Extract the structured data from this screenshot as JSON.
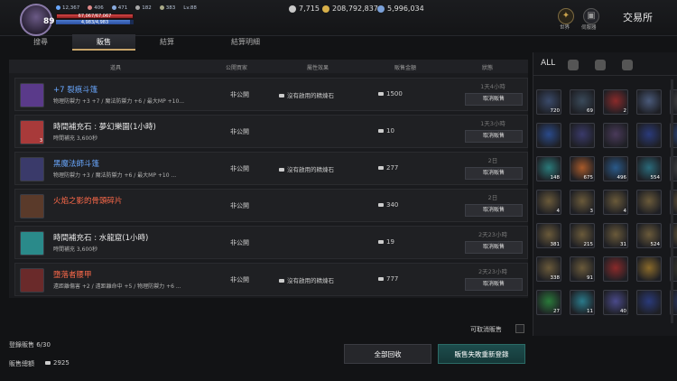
{
  "player": {
    "level": "89",
    "stats": [
      "12,367",
      "406",
      "471",
      "182",
      "383"
    ],
    "lvl_tag": "Lv.88",
    "hp_text": "67,067/67,067",
    "mp_text": "4,983/4,983"
  },
  "currency": [
    {
      "value": "7,715",
      "color": "#c8c8c8"
    },
    {
      "value": "208,792,837",
      "color": "#d8b04a"
    },
    {
      "value": "5,996,034",
      "color": "#7aa0d8"
    }
  ],
  "top_icons": [
    {
      "label": "世界"
    },
    {
      "label": "伺服器"
    }
  ],
  "page_title": "交易所",
  "tabs": [
    "搜尋",
    "販售",
    "結算",
    "結算明細"
  ],
  "header": {
    "item": "道具",
    "public": "公開買家",
    "attr": "屬性效果",
    "price": "販售金額",
    "status": "狀態"
  },
  "rows": [
    {
      "name": "+7 裂痕斗篷",
      "name_class": "blue",
      "desc": "物理防禦力 +3 +7 / 魔法防禦力 +6 / 最大MP +10...",
      "pub": "非公開",
      "attr": "沒有啟用的精煉石",
      "price": "1500",
      "time": "1天4小時",
      "button": "取消販售",
      "icon_color": "#5a3a8a",
      "count": ""
    },
    {
      "name": "時間補充石 : 夢幻樂園(1小時)",
      "name_class": "white",
      "desc": "時間補充 3,600秒",
      "pub": "非公開",
      "attr": "",
      "price": "10",
      "time": "1天3小時",
      "button": "取消販售",
      "icon_color": "#a83a3a",
      "count": "3"
    },
    {
      "name": "黑魔法師斗篷",
      "name_class": "blue",
      "desc": "物理防禦力 +3 / 魔法防禦力 +6 / 最大MP +10 ...",
      "pub": "非公開",
      "attr": "沒有啟用的精煉石",
      "price": "277",
      "time": "2日",
      "button": "取消販售",
      "icon_color": "#3a3a6a",
      "count": ""
    },
    {
      "name": "火焰之影的骨頭碎片",
      "name_class": "red",
      "desc": "",
      "pub": "非公開",
      "attr": "",
      "price": "340",
      "time": "2日",
      "button": "取消販售",
      "icon_color": "#5a3a2a",
      "count": ""
    },
    {
      "name": "時間補充石 : 水龍窟(1小時)",
      "name_class": "white",
      "desc": "時間補充 3,600秒",
      "pub": "非公開",
      "attr": "",
      "price": "19",
      "time": "2天23小時",
      "button": "取消販售",
      "icon_color": "#2a8a8a",
      "count": ""
    },
    {
      "name": "墮落者腰甲",
      "name_class": "red",
      "desc": "遠距離傷害 +2 / 遠距離命中 +5 / 物理防禦力 +6 ...",
      "pub": "非公開",
      "attr": "沒有啟用的精煉石",
      "price": "777",
      "time": "2天23小時",
      "button": "取消販售",
      "icon_color": "#6a2a2a",
      "count": ""
    }
  ],
  "footer": {
    "cancelable": "可取消販售",
    "registered": "登錄販售 6/30",
    "total_label": "販售總額",
    "total": "2925",
    "btn_recover": "全部回收",
    "btn_reregister": "販售失敗重新登錄"
  },
  "inventory": {
    "all_tab": "ALL",
    "counts": [
      "720",
      "69",
      "2",
      "",
      "",
      "",
      "",
      "",
      "",
      "",
      "148",
      "675",
      "496",
      "554",
      "",
      "4",
      "3",
      "4",
      "",
      "4",
      "381",
      "215",
      "31",
      "524",
      "",
      "338",
      "91",
      "",
      "",
      "",
      "27",
      "11",
      "40",
      "",
      ""
    ],
    "colors": [
      "#3a4a6a",
      "#3a4a5a",
      "#8a2a2a",
      "#4a5a7a",
      "#4a4a4a",
      "#2a4a8a",
      "#3a3a6a",
      "#4a3a5a",
      "#2a3a7a",
      "#2a4a8a",
      "#2a7a7a",
      "#a85a2a",
      "#2a5a8a",
      "#2a6a7a",
      "#4a4a4a",
      "#6a5a3a",
      "#6a5a3a",
      "#6a5a3a",
      "#6a5a3a",
      "#6a5a3a",
      "#6a5a3a",
      "#6a5a3a",
      "#6a5a3a",
      "#6a5a3a",
      "#6a5a3a",
      "#6a5a3a",
      "#6a5a3a",
      "#8a2a2a",
      "#8a6a2a",
      "#3a3a2a",
      "#2a7a3a",
      "#2a7a8a",
      "#4a4a8a",
      "#2a3a7a",
      "#2a3a6a"
    ]
  }
}
